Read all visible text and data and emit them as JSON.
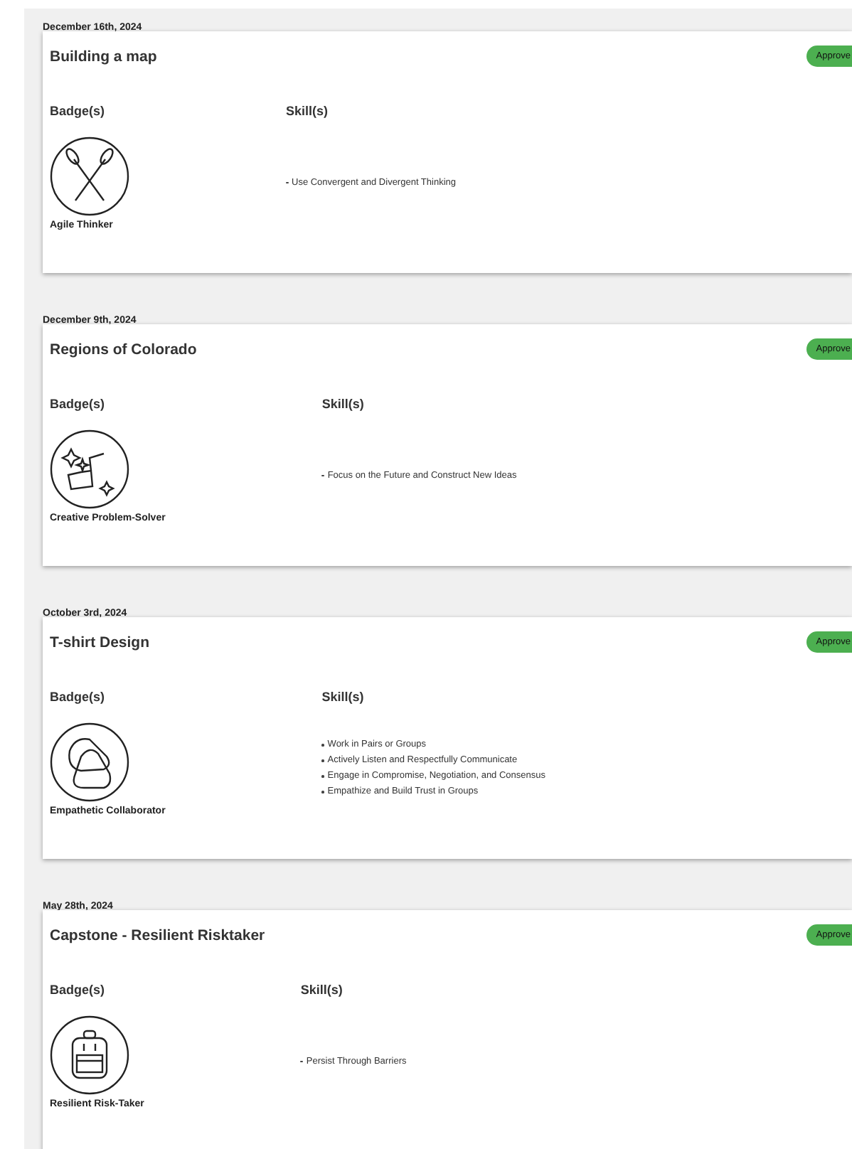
{
  "entries": [
    {
      "date": "December 16th, 2024",
      "title": "Building a map",
      "status": "Approve",
      "badges_heading": "Badge(s)",
      "skills_heading": "Skill(s)",
      "badges": [
        {
          "name": "Agile Thinker",
          "kind": "paddles"
        }
      ],
      "skills": [
        "Use Convergent and Divergent Thinking"
      ]
    },
    {
      "date": "December 9th, 2024",
      "title": "Regions of Colorado",
      "status": "Approve",
      "badges_heading": "Badge(s)",
      "skills_heading": "Skill(s)",
      "badges": [
        {
          "name": "Creative Problem-Solver",
          "kind": "stars"
        }
      ],
      "skills": [
        "Focus on the Future and Construct New Ideas"
      ]
    },
    {
      "date": "October 3rd, 2024",
      "title": "T-shirt Design",
      "status": "Approve",
      "badges_heading": "Badge(s)",
      "skills_heading": "Skill(s)",
      "badges": [
        {
          "name": "Empathetic Collaborator",
          "kind": "carabiners"
        }
      ],
      "skills": [
        "Work in Pairs or Groups",
        "Actively Listen and Respectfully Communicate",
        "Engage in Compromise, Negotiation, and Consensus",
        "Empathize and Build Trust in Groups"
      ]
    },
    {
      "date": "May 28th, 2024",
      "title": "Capstone - Resilient Risktaker",
      "status": "Approve",
      "badges_heading": "Badge(s)",
      "skills_heading": "Skill(s)",
      "badges": [
        {
          "name": "Resilient Risk-Taker",
          "kind": "backpack"
        }
      ],
      "skills": [
        "Persist Through Barriers"
      ]
    }
  ]
}
